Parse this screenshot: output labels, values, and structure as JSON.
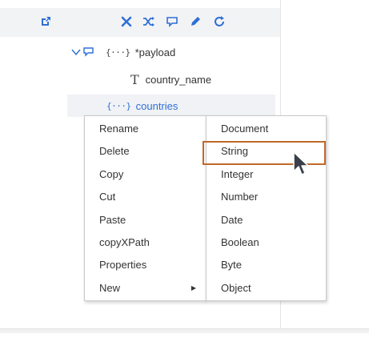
{
  "toolbar": {
    "icons": [
      "external-link-icon",
      "close-icon",
      "shuffle-icon",
      "comment-icon",
      "edit-icon",
      "refresh-icon"
    ]
  },
  "tree": {
    "payload": {
      "brace": "{···}",
      "label": "*payload"
    },
    "country_name": {
      "type_glyph": "T",
      "label": "country_name"
    },
    "countries": {
      "brace": "{···}",
      "label": "countries"
    }
  },
  "context_menu": {
    "items": [
      {
        "label": "Rename"
      },
      {
        "label": "Delete"
      },
      {
        "label": "Copy"
      },
      {
        "label": "Cut"
      },
      {
        "label": "Paste"
      },
      {
        "label": "copyXPath"
      },
      {
        "label": "Properties"
      },
      {
        "label": "New",
        "submenu_indicator": "▶"
      }
    ]
  },
  "submenu": {
    "items": [
      {
        "label": "Document"
      },
      {
        "label": "String"
      },
      {
        "label": "Integer"
      },
      {
        "label": "Number"
      },
      {
        "label": "Date"
      },
      {
        "label": "Boolean"
      },
      {
        "label": "Byte"
      },
      {
        "label": "Object"
      }
    ],
    "highlighted": "String"
  },
  "colors": {
    "accent": "#2e6fd6",
    "highlight_border": "#c0692a",
    "toolbar_bg": "#f2f3f5"
  }
}
